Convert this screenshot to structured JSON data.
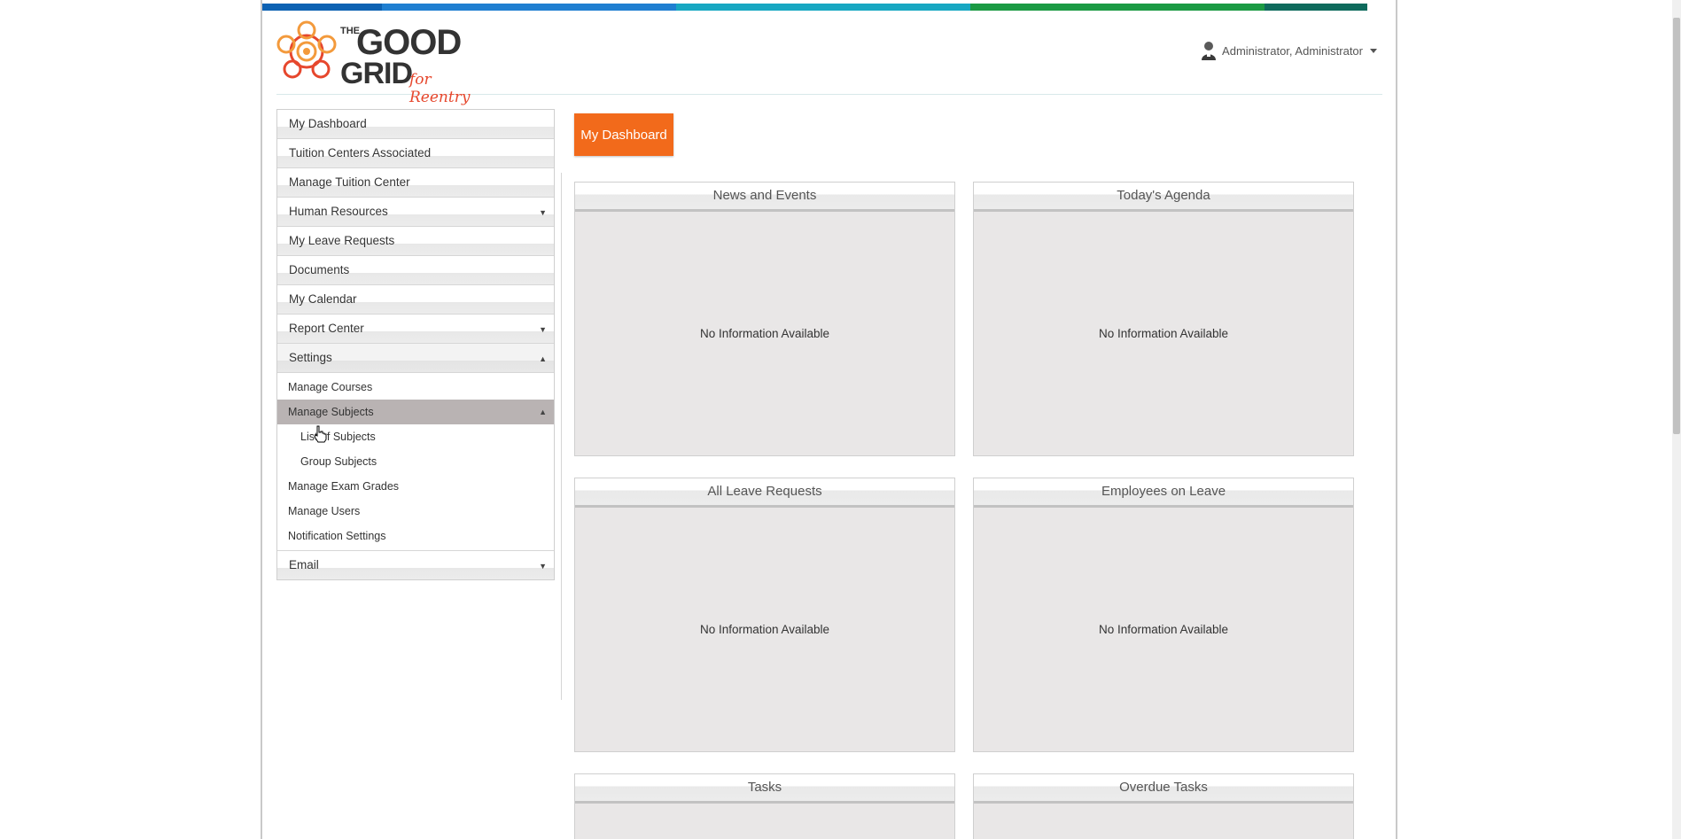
{
  "colors": {
    "topbar": [
      "#0d62b3",
      "#1f7fd1",
      "#17a7c2",
      "#1b9a43",
      "#0e6a5c"
    ],
    "accent": "#f26a1b",
    "logo_orange": "#f39a3c",
    "logo_red": "#e6472d"
  },
  "logo": {
    "the": "THE",
    "good": "GOOD",
    "grid": "GRID",
    "tagline": "for Reentry"
  },
  "user": {
    "name": "Administrator, Administrator",
    "icon": "user-avatar-icon"
  },
  "sidebar": {
    "items": [
      {
        "label": "My Dashboard"
      },
      {
        "label": "Tuition Centers Associated"
      },
      {
        "label": "Manage Tuition Center"
      },
      {
        "label": "Human Resources",
        "arrow": "▼"
      },
      {
        "label": "My Leave Requests"
      },
      {
        "label": "Documents"
      },
      {
        "label": "My Calendar"
      },
      {
        "label": "Report Center",
        "arrow": "▼"
      },
      {
        "label": "Settings",
        "arrow": "▲"
      }
    ],
    "settings_sub": [
      {
        "label": "Manage Courses"
      },
      {
        "label": "Manage Subjects",
        "arrow": "▲"
      },
      {
        "label": "List of Subjects"
      },
      {
        "label": "Group Subjects"
      },
      {
        "label": "Manage Exam Grades"
      },
      {
        "label": "Manage Users"
      },
      {
        "label": "Notification Settings"
      }
    ],
    "email": {
      "label": "Email",
      "arrow": "▼"
    }
  },
  "main": {
    "dashboard_button": "My Dashboard",
    "panels": [
      {
        "title": "News and Events",
        "body": "No Information Available"
      },
      {
        "title": "Today's Agenda",
        "body": "No Information Available"
      },
      {
        "title": "All Leave Requests",
        "body": "No Information Available"
      },
      {
        "title": "Employees on Leave",
        "body": "No Information Available"
      },
      {
        "title": "Tasks",
        "body": ""
      },
      {
        "title": "Overdue Tasks",
        "body": ""
      }
    ]
  }
}
